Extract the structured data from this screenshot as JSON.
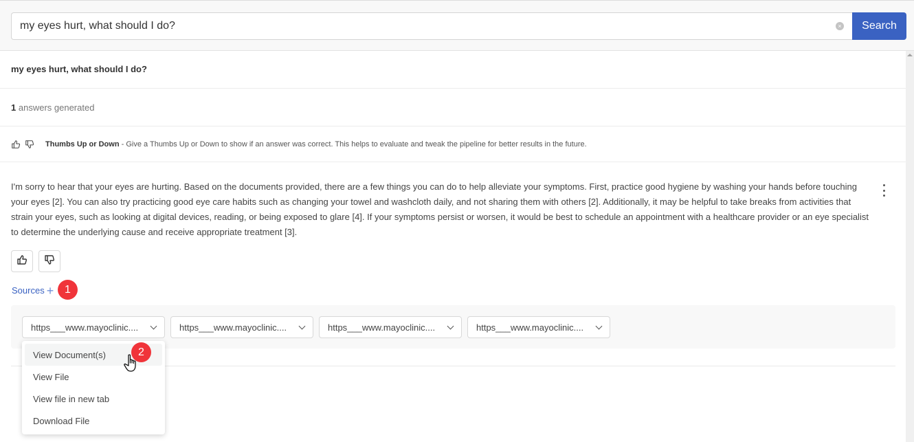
{
  "search": {
    "value": "my eyes hurt, what should I do?",
    "button_label": "Search"
  },
  "question": "my eyes hurt, what should I do?",
  "answers_count": "1",
  "answers_label": "answers generated",
  "feedback": {
    "title": "Thumbs Up or Down",
    "separator": " - ",
    "description": "Give a Thumbs Up or Down to show if an answer was correct. This helps to evaluate and tweak the pipeline for better results in the future."
  },
  "answer": {
    "text": "I'm sorry to hear that your eyes are hurting. Based on the documents provided, there are a few things you can do to help alleviate your symptoms. First, practice good hygiene by washing your hands before touching your eyes [2]. You can also try practicing good eye care habits such as changing your towel and washcloth daily, and not sharing them with others [2]. Additionally, it may be helpful to take breaks from activities that strain your eyes, such as looking at digital devices, reading, or being exposed to glare [4]. If your symptoms persist or worsen, it would be best to schedule an appointment with a healthcare provider or an eye specialist to determine the underlying cause and receive appropriate treatment [3]."
  },
  "sources": {
    "label": "Sources",
    "plus": "+",
    "items": [
      {
        "label": "https___www.mayoclinic...."
      },
      {
        "label": "https___www.mayoclinic...."
      },
      {
        "label": "https___www.mayoclinic...."
      },
      {
        "label": "https___www.mayoclinic...."
      }
    ]
  },
  "menu": {
    "items": [
      {
        "label": "View Document(s)"
      },
      {
        "label": "View File"
      },
      {
        "label": "View file in new tab"
      },
      {
        "label": "Download File"
      }
    ]
  },
  "badges": {
    "step1": "1",
    "step2": "2"
  },
  "colors": {
    "accent": "#3a62c2",
    "badge": "#f0343a"
  }
}
